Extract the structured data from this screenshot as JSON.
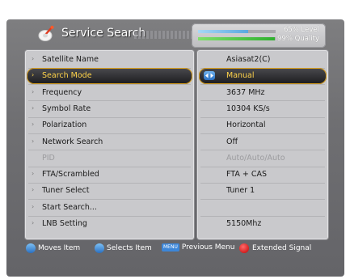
{
  "header": {
    "title": "Service Search",
    "icon": "satellite-dish-icon",
    "signal": {
      "level_label": "65% Level",
      "quality_label": "99% Quality",
      "level": 0.65,
      "quality": 0.99
    }
  },
  "menu": {
    "items": [
      {
        "label": "Satellite Name",
        "value": "Asiasat2(C)"
      },
      {
        "label": "Search Mode",
        "value": "Manual"
      },
      {
        "label": "Frequency",
        "value": "3637 MHz"
      },
      {
        "label": "Symbol Rate",
        "value": "10304 KS/s"
      },
      {
        "label": "Polarization",
        "value": "Horizontal"
      },
      {
        "label": "Network Search",
        "value": "Off"
      },
      {
        "label": "PID",
        "value": "Auto/Auto/Auto"
      },
      {
        "label": "FTA/Scrambled",
        "value": "FTA + CAS"
      },
      {
        "label": "Tuner Select",
        "value": "Tuner 1"
      },
      {
        "label": "Start Search...",
        "value": ""
      },
      {
        "label": "LNB Setting",
        "value": "5150Mhz"
      }
    ],
    "selected_index": 1,
    "disabled_index": 6
  },
  "footer": {
    "moves_label": "Moves Item",
    "selects_label": "Selects Item",
    "menu_key": "MENU",
    "previous_label": "Previous Menu",
    "extended_label": "Extended Signal"
  },
  "colors": {
    "selection_text": "#ffd34a",
    "panel_bg": "#c9c9cc",
    "screen_bg": "#6f6f72",
    "red_key": "#c00000",
    "blue_key": "#2a6fc0"
  }
}
